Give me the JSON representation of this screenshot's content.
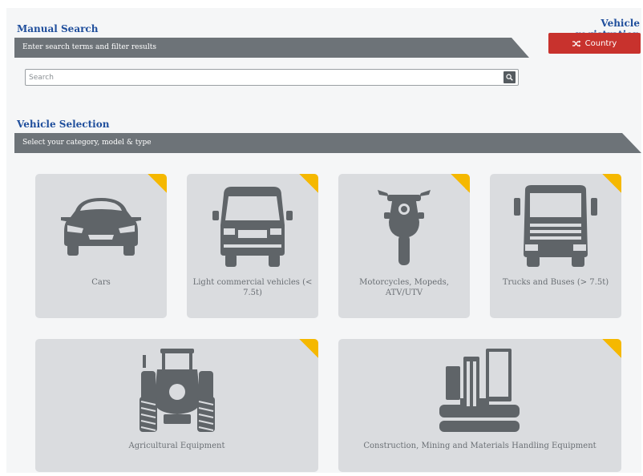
{
  "manual_search": {
    "title": "Manual Search",
    "banner": "Enter search terms and filter results",
    "search_placeholder": "Search"
  },
  "registration": {
    "title": "Vehicle registration",
    "button_icon": "shuffle-icon",
    "button_label": "Country"
  },
  "vehicle_selection": {
    "title": "Vehicle Selection",
    "banner": "Select your category, model & type",
    "categories": [
      {
        "label": "Cars",
        "icon": "car-icon"
      },
      {
        "label": "Light commercial vehicles (< 7.5t)",
        "icon": "van-icon"
      },
      {
        "label": "Motorcycles, Mopeds, ATV/UTV",
        "icon": "motorcycle-icon"
      },
      {
        "label": "Trucks and Buses (> 7.5t)",
        "icon": "truck-icon"
      },
      {
        "label": "Agricultural Equipment",
        "icon": "tractor-icon"
      },
      {
        "label": "Construction, Mining and Materials Handling Equipment",
        "icon": "excavator-icon"
      }
    ]
  },
  "colors": {
    "accent_blue": "#1f4e9c",
    "banner_gray": "#6d7378",
    "country_red": "#c8322d",
    "corner_yellow": "#f5b800",
    "card_gray": "#dadcdf",
    "icon_gray": "#5f6468"
  }
}
